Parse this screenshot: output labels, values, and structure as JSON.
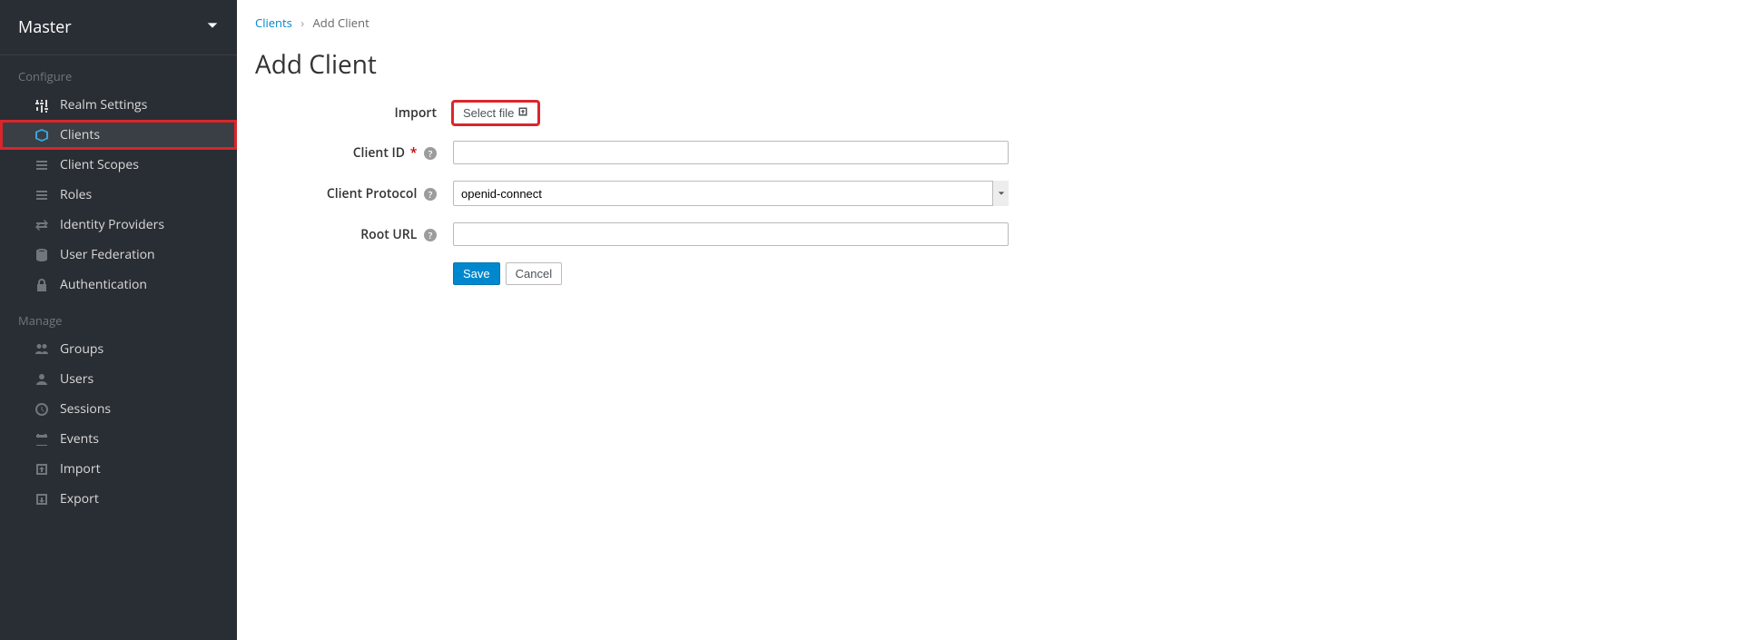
{
  "realm": {
    "name": "Master"
  },
  "sidebar": {
    "sections": [
      {
        "header": "Configure",
        "items": [
          {
            "label": "Realm Settings",
            "icon": "sliders"
          },
          {
            "label": "Clients",
            "icon": "cube",
            "active": true,
            "highlighted": true
          },
          {
            "label": "Client Scopes",
            "icon": "list"
          },
          {
            "label": "Roles",
            "icon": "bars"
          },
          {
            "label": "Identity Providers",
            "icon": "exchange"
          },
          {
            "label": "User Federation",
            "icon": "database"
          },
          {
            "label": "Authentication",
            "icon": "lock"
          }
        ]
      },
      {
        "header": "Manage",
        "items": [
          {
            "label": "Groups",
            "icon": "users"
          },
          {
            "label": "Users",
            "icon": "user"
          },
          {
            "label": "Sessions",
            "icon": "clock"
          },
          {
            "label": "Events",
            "icon": "calendar"
          },
          {
            "label": "Import",
            "icon": "import"
          },
          {
            "label": "Export",
            "icon": "export"
          }
        ]
      }
    ]
  },
  "breadcrumb": {
    "parent": "Clients",
    "current": "Add Client"
  },
  "page": {
    "title": "Add Client"
  },
  "form": {
    "import_label": "Import",
    "select_file_label": "Select file",
    "client_id_label": "Client ID",
    "client_id_value": "",
    "client_protocol_label": "Client Protocol",
    "client_protocol_value": "openid-connect",
    "root_url_label": "Root URL",
    "root_url_value": "",
    "save_label": "Save",
    "cancel_label": "Cancel"
  }
}
